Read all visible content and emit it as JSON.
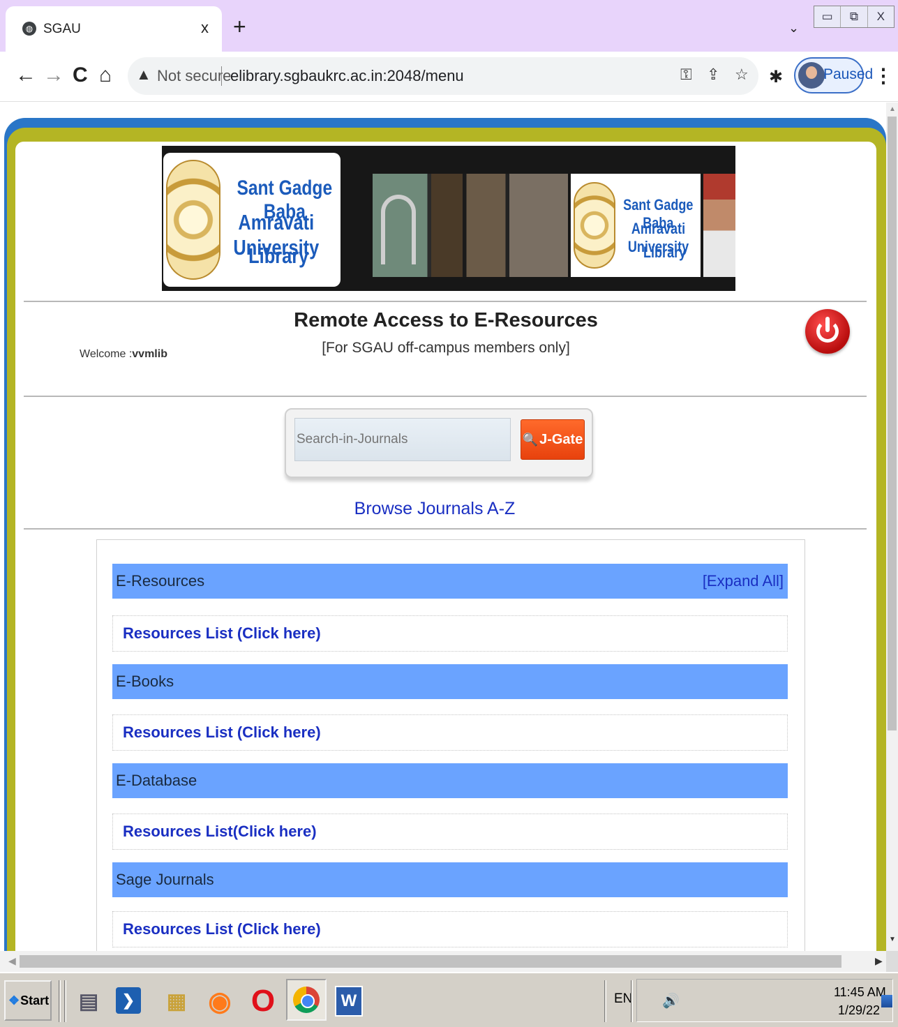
{
  "browser": {
    "tab_title": "SGAU",
    "close_glyph": "x",
    "new_tab_glyph": "+",
    "tab_menu_glyph": "⌄",
    "window_controls": [
      "▭",
      "⧉",
      "X"
    ],
    "nav": {
      "back": "←",
      "forward": "→",
      "reload": "C",
      "home": "⌂"
    },
    "not_secure_glyph": "▲",
    "not_secure_label": "Not secure",
    "url": "elibrary.sgbaukrc.ac.in:2048/menu",
    "omnibox_icons": {
      "key": "⚿",
      "share": "⇪",
      "star": "☆"
    },
    "extensions_glyph": "✱",
    "profile_status": "Paused",
    "menu_glyph": "⋮"
  },
  "banner": {
    "logo_lines": [
      "Sant Gadge Baba",
      "Amravati University",
      "Library"
    ],
    "logo_lines_2": [
      "Sant Gadge Baba",
      "Amravati University",
      "Library"
    ]
  },
  "header": {
    "welcome_prefix": "Welcome :",
    "username": "vvmlib",
    "title": "Remote Access to E-Resources",
    "subtitle": "[For SGAU off-campus members only]"
  },
  "search": {
    "placeholder": "Search-in-Journals",
    "button_label": "J-Gate",
    "button_icon": "🔍"
  },
  "browse_link": "Browse Journals A-Z",
  "menu": {
    "expand_all": "[Expand All]",
    "sections": [
      {
        "title": "E-Resources",
        "link": "Resources List (Click here)"
      },
      {
        "title": "E-Books",
        "link": "Resources List (Click here)"
      },
      {
        "title": "E-Database",
        "link": "Resources List(Click here)"
      },
      {
        "title": "Sage Journals",
        "link": "Resources List (Click here)"
      }
    ]
  },
  "scrollbars": {
    "up": "▲",
    "down": "▼",
    "left": "◀",
    "right": "▶"
  },
  "taskbar": {
    "start_label": "Start",
    "start_glyph": "❖",
    "apps": [
      "▤",
      "❯",
      "▦",
      "◉",
      "O",
      "",
      "W"
    ],
    "language": "EN",
    "volume_glyph": "🔊",
    "time": "11:45 AM",
    "date": "1/29/22"
  }
}
